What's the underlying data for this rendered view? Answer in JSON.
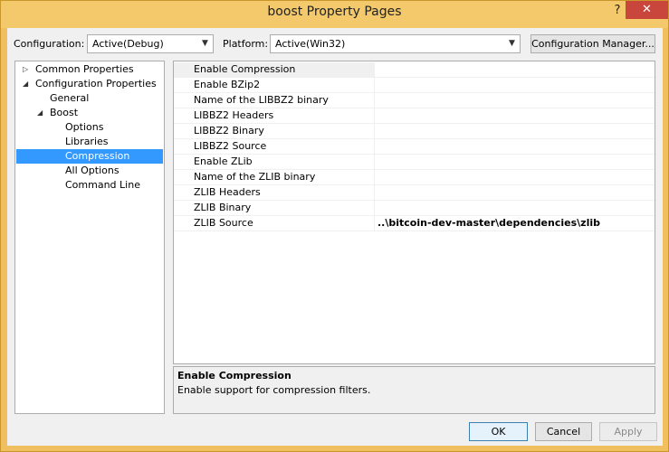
{
  "window": {
    "title": "boost Property Pages",
    "help_glyph": "?",
    "close_glyph": "✕"
  },
  "toolbar": {
    "configuration_label": "Configuration:",
    "configuration_value": "Active(Debug)",
    "platform_label": "Platform:",
    "platform_value": "Active(Win32)",
    "config_manager_label": "Configuration Manager..."
  },
  "tree": {
    "items": [
      {
        "label": "Common Properties",
        "expander": "▷"
      },
      {
        "label": "Configuration Properties",
        "expander": "◢"
      },
      {
        "label": "General"
      },
      {
        "label": "Boost",
        "expander": "◢"
      },
      {
        "label": "Options"
      },
      {
        "label": "Libraries"
      },
      {
        "label": "Compression"
      },
      {
        "label": "All Options"
      },
      {
        "label": "Command Line"
      }
    ],
    "selected": "Compression"
  },
  "properties": {
    "rows": [
      {
        "name": "Enable Compression",
        "value": ""
      },
      {
        "name": "Enable BZip2",
        "value": ""
      },
      {
        "name": "Name of the LIBBZ2 binary",
        "value": ""
      },
      {
        "name": "LIBBZ2 Headers",
        "value": ""
      },
      {
        "name": "LIBBZ2 Binary",
        "value": ""
      },
      {
        "name": "LIBBZ2 Source",
        "value": ""
      },
      {
        "name": "Enable ZLib",
        "value": ""
      },
      {
        "name": "Name of the ZLIB binary",
        "value": ""
      },
      {
        "name": "ZLIB Headers",
        "value": ""
      },
      {
        "name": "ZLIB Binary",
        "value": ""
      },
      {
        "name": "ZLIB Source",
        "value": "..\\bitcoin-dev-master\\dependencies\\zlib"
      }
    ]
  },
  "description": {
    "title": "Enable Compression",
    "text": "Enable support for compression filters."
  },
  "buttons": {
    "ok": "OK",
    "cancel": "Cancel",
    "apply": "Apply"
  },
  "colors": {
    "titlebar": "#f3c96b",
    "close_button": "#c9463d",
    "selection": "#3399ff"
  }
}
